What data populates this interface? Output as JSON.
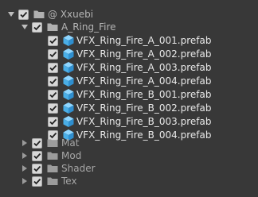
{
  "tree": {
    "root": {
      "label": "@ Xxuebi",
      "checked": true,
      "expanded": true
    },
    "subfolder": {
      "label": "A_Ring_Fire",
      "checked": true,
      "expanded": true
    },
    "prefabs": [
      {
        "label": "VFX_Ring_Fire_A_001.prefab",
        "checked": true
      },
      {
        "label": "VFX_Ring_Fire_A_002.prefab",
        "checked": true
      },
      {
        "label": "VFX_Ring_Fire_A_003.prefab",
        "checked": true
      },
      {
        "label": "VFX_Ring_Fire_A_004.prefab",
        "checked": true
      },
      {
        "label": "VFX_Ring_Fire_B_001.prefab",
        "checked": true
      },
      {
        "label": "VFX_Ring_Fire_B_002.prefab",
        "checked": true
      },
      {
        "label": "VFX_Ring_Fire_B_003.prefab",
        "checked": true
      },
      {
        "label": "VFX_Ring_Fire_B_004.prefab",
        "checked": true
      }
    ],
    "folders": [
      {
        "label": "Mat",
        "checked": true,
        "expanded": false
      },
      {
        "label": "Mod",
        "checked": true,
        "expanded": false
      },
      {
        "label": "Shader",
        "checked": true,
        "expanded": false
      },
      {
        "label": "Tex",
        "checked": true,
        "expanded": false
      }
    ]
  },
  "colors": {
    "background": "#383838",
    "folder_icon": "#b0b0b0",
    "prefab_icon": "#5bbcf0",
    "checkbox": "#d8d8d8",
    "checkmark": "#222222"
  },
  "icons": {
    "expanded": "triangle-down-icon",
    "collapsed": "triangle-right-icon",
    "folder": "folder-icon",
    "prefab": "prefab-cube-icon",
    "check": "checkmark-icon"
  }
}
